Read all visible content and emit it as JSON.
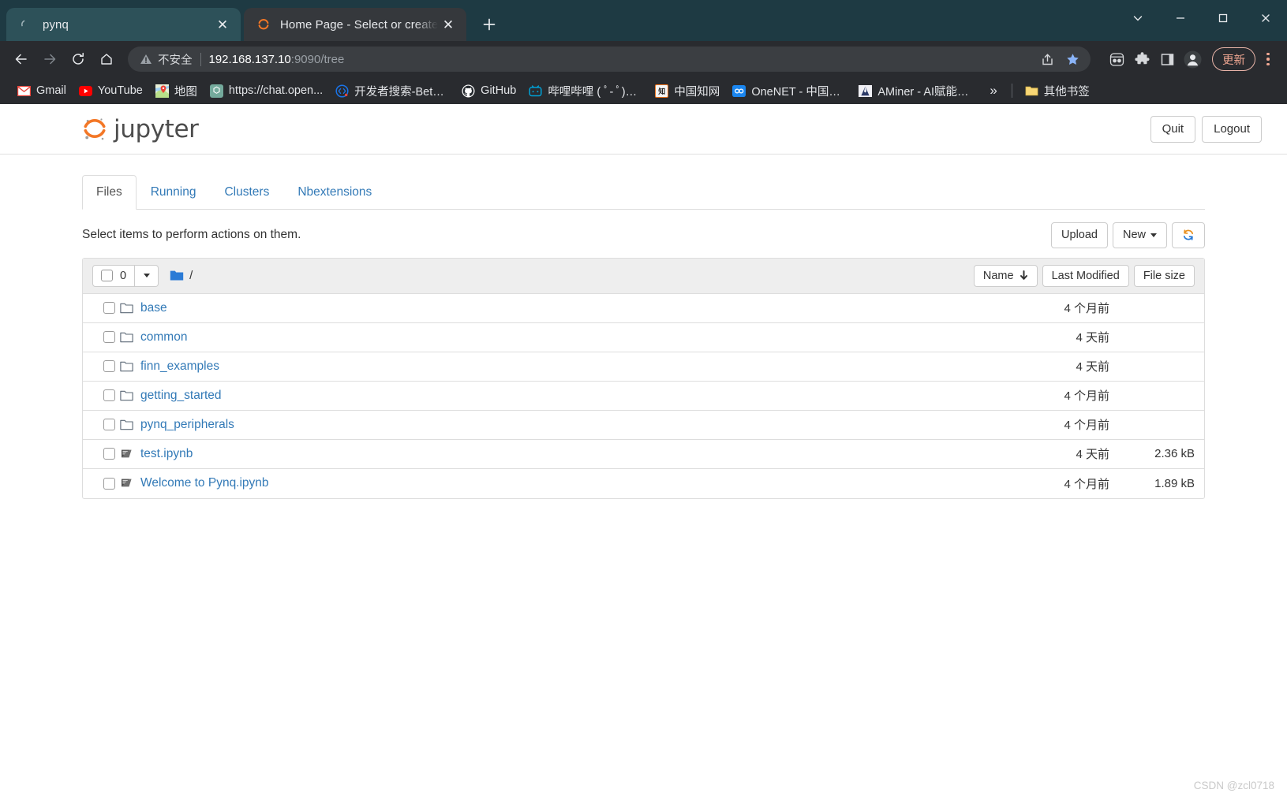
{
  "browser": {
    "tabs": [
      {
        "title": "pynq",
        "favicon": "jupyter-spinner-icon",
        "active": false
      },
      {
        "title": "Home Page - Select or create a",
        "favicon": "jupyter-icon",
        "active": true
      }
    ],
    "new_tab_label": "+",
    "window_controls": {
      "expand": "v",
      "minimize": "–",
      "maximize": "□",
      "close": "✕"
    },
    "toolbar": {
      "back": "back-icon",
      "forward": "forward-icon",
      "reload": "reload-icon",
      "home": "home-icon",
      "security_label": "不安全",
      "url_host": "192.168.137.10",
      "url_path": ":9090/tree",
      "share_icon": "share-icon",
      "bookmark_icon": "star-icon",
      "extensions": [
        "toolbar-extension-icon",
        "puzzle-icon",
        "sidepanel-icon",
        "profile-avatar-icon"
      ],
      "update_label": "更新",
      "menu_icon": "kebab-menu-icon"
    },
    "bookmarks": [
      {
        "label": "Gmail",
        "icon": "gmail-icon"
      },
      {
        "label": "YouTube",
        "icon": "youtube-icon"
      },
      {
        "label": "地图",
        "icon": "google-maps-icon"
      },
      {
        "label": "https://chat.open...",
        "icon": "openai-icon"
      },
      {
        "label": "开发者搜索-Beta-...",
        "icon": "devsearch-icon"
      },
      {
        "label": "GitHub",
        "icon": "github-icon"
      },
      {
        "label": "哔哩哔哩 ( ﾟ- ﾟ)つ...",
        "icon": "bilibili-icon"
      },
      {
        "label": "中国知网",
        "icon": "cnki-icon"
      },
      {
        "label": "OneNET - 中国移...",
        "icon": "onenet-icon"
      },
      {
        "label": "AMiner - AI赋能科...",
        "icon": "aminer-icon"
      }
    ],
    "bookmarks_overflow": "»",
    "other_bookmarks": {
      "label": "其他书签",
      "icon": "folder-icon"
    }
  },
  "jupyter": {
    "logo_text": "jupyter",
    "logo_icon": "jupyter-logo-icon",
    "quit_label": "Quit",
    "logout_label": "Logout",
    "tabs": [
      {
        "label": "Files",
        "selected": true
      },
      {
        "label": "Running",
        "selected": false
      },
      {
        "label": "Clusters",
        "selected": false
      },
      {
        "label": "Nbextensions",
        "selected": false
      }
    ],
    "hint": "Select items to perform actions on them.",
    "upload_label": "Upload",
    "new_label": "New",
    "refresh_icon": "refresh-icon",
    "list_header": {
      "selected_count": "0",
      "dropdown_icon": "caret-down-icon",
      "breadcrumb_icon": "folder-icon",
      "breadcrumb_path": "/",
      "sort_name": "Name",
      "sort_name_arrow": "⬇",
      "sort_last_modified": "Last Modified",
      "sort_file_size": "File size"
    },
    "items": [
      {
        "name": "base",
        "type": "folder",
        "modified": "4 个月前",
        "size": ""
      },
      {
        "name": "common",
        "type": "folder",
        "modified": "4 天前",
        "size": ""
      },
      {
        "name": "finn_examples",
        "type": "folder",
        "modified": "4 天前",
        "size": ""
      },
      {
        "name": "getting_started",
        "type": "folder",
        "modified": "4 个月前",
        "size": ""
      },
      {
        "name": "pynq_peripherals",
        "type": "folder",
        "modified": "4 个月前",
        "size": ""
      },
      {
        "name": "test.ipynb",
        "type": "notebook",
        "modified": "4 天前",
        "size": "2.36 kB"
      },
      {
        "name": "Welcome to Pynq.ipynb",
        "type": "notebook",
        "modified": "4 个月前",
        "size": "1.89 kB"
      }
    ]
  },
  "watermark": "CSDN @zcl0718",
  "colors": {
    "chrome_tabstrip": "#1e3a43",
    "chrome_toolbar": "#292b2f",
    "active_tab": "#35383c",
    "jupyter_orange": "#f37726",
    "link_blue": "#337ab7",
    "update_accent": "#f0a792"
  }
}
